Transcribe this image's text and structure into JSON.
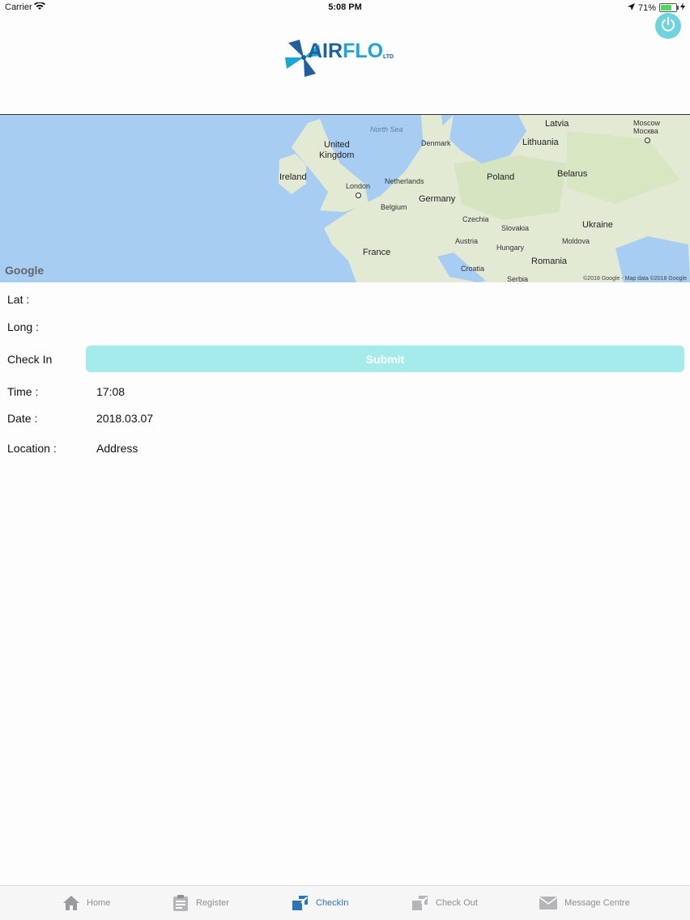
{
  "status_bar": {
    "carrier": "Carrier",
    "time": "5:08 PM",
    "battery": "71%"
  },
  "header": {
    "logo_air": "AIR",
    "logo_flo": "FLO",
    "logo_ltd": "LTD"
  },
  "map": {
    "labels": {
      "north_sea": "North Sea",
      "latvia": "Latvia",
      "moscow_en": "Moscow",
      "moscow_ru": "Москва",
      "united": "United",
      "kingdom": "Kingdom",
      "denmark": "Denmark",
      "lithuania": "Lithuania",
      "ireland": "Ireland",
      "netherlands": "Netherlands",
      "poland": "Poland",
      "belarus": "Belarus",
      "london": "London",
      "germany": "Germany",
      "belgium": "Belgium",
      "czechia": "Czechia",
      "ukraine": "Ukraine",
      "slovakia": "Slovakia",
      "austria": "Austria",
      "moldova": "Moldova",
      "france": "France",
      "hungary": "Hungary",
      "romania": "Romania",
      "croatia": "Croatia",
      "serbia": "Serbia"
    },
    "google_logo": "Google",
    "attribution": "©2018 Google - Map data ©2018 Google"
  },
  "form": {
    "lat_label": "Lat :",
    "long_label": "Long :",
    "checkin_label": "Check In",
    "submit_label": "Submit",
    "time_label": "Time :",
    "time_value": "17:08",
    "date_label": "Date :",
    "date_value": "2018.03.07",
    "location_label": "Location :",
    "location_value": "Address"
  },
  "tabs": [
    {
      "label": "Home",
      "icon": "home-icon"
    },
    {
      "label": "Register",
      "icon": "clipboard-icon"
    },
    {
      "label": "CheckIn",
      "icon": "checkin-icon"
    },
    {
      "label": "Check Out",
      "icon": "checkout-icon"
    },
    {
      "label": "Message Centre",
      "icon": "envelope-icon"
    }
  ],
  "colors": {
    "accent": "#6fd3dd",
    "submit_bg": "#a5ebeb",
    "active_tab": "#2b76b9",
    "inactive_tab": "#8e8e93"
  }
}
